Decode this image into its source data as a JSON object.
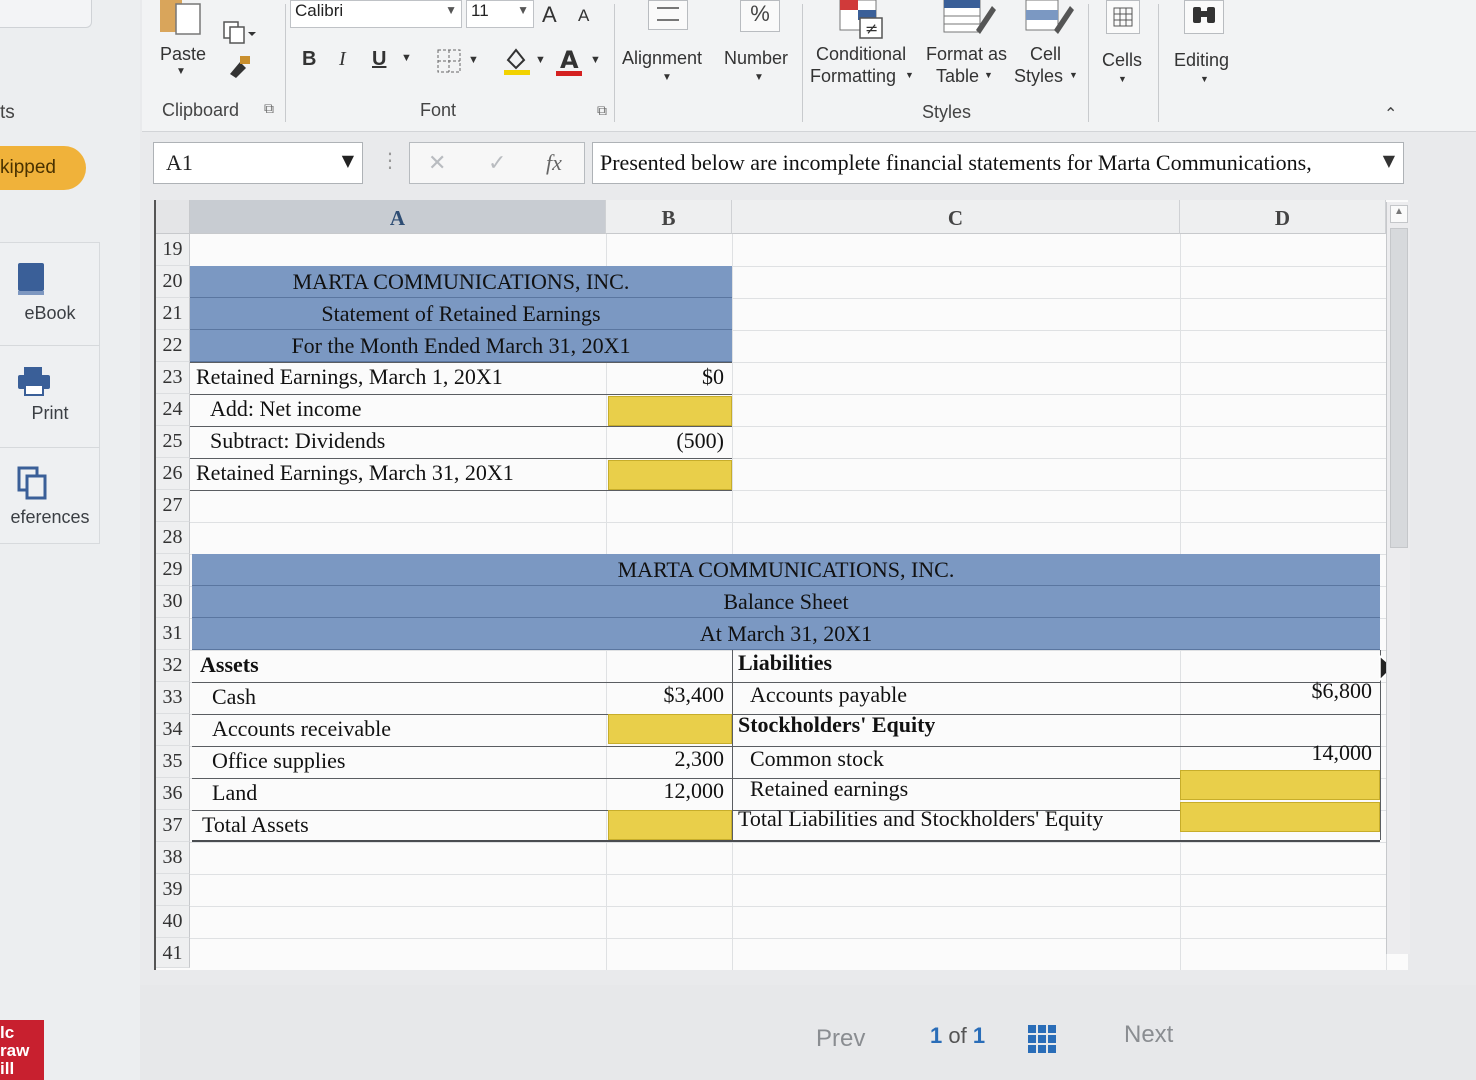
{
  "siderail": {
    "top_text": "ts",
    "skipped": "kipped",
    "ebook": "eBook",
    "print": "Print",
    "references": "eferences",
    "logo_lines": [
      "lc",
      "raw",
      "ill"
    ]
  },
  "ribbon": {
    "paste": "Paste",
    "clipboard": "Clipboard",
    "font_name": "Calibri",
    "font_size": "11",
    "grow_font": "A",
    "shrink_font": "A",
    "bold": "B",
    "italic": "I",
    "underline": "U",
    "font_group": "Font",
    "alignment": "Alignment",
    "number": "Number",
    "number_symbol": "%",
    "conditional_formatting_1": "Conditional",
    "conditional_formatting_2": "Formatting",
    "format_as_table_1": "Format as",
    "format_as_table_2": "Table",
    "cell_styles_1": "Cell",
    "cell_styles_2": "Styles",
    "styles_group": "Styles",
    "cells": "Cells",
    "editing": "Editing"
  },
  "formula_bar": {
    "name_box": "A1",
    "fx": "fx",
    "content": "Presented below are incomplete financial statements for Marta Communications,"
  },
  "columns": [
    "A",
    "B",
    "C",
    "D"
  ],
  "rows": [
    "19",
    "20",
    "21",
    "22",
    "23",
    "24",
    "25",
    "26",
    "27",
    "28",
    "29",
    "30",
    "31",
    "32",
    "33",
    "34",
    "35",
    "36",
    "37",
    "38",
    "39",
    "40",
    "41"
  ],
  "retained_earnings_statement": {
    "company": "MARTA COMMUNICATIONS, INC.",
    "title": "Statement of Retained Earnings",
    "period": "For the Month Ended  March 31, 20X1",
    "lines": [
      {
        "label": "Retained Earnings, March 1, 20X1",
        "value": "$0"
      },
      {
        "label": "Add: Net income",
        "value": ""
      },
      {
        "label": "Subtract: Dividends",
        "value": "(500)"
      },
      {
        "label": "Retained Earnings, March 31, 20X1",
        "value": ""
      }
    ]
  },
  "balance_sheet": {
    "company": "MARTA COMMUNICATIONS, INC.",
    "title": "Balance Sheet",
    "date": "At March 31, 20X1",
    "assets_header": "Assets",
    "assets": [
      {
        "label": "Cash",
        "value": "$3,400"
      },
      {
        "label": "Accounts receivable",
        "value": ""
      },
      {
        "label": "Office supplies",
        "value": "2,300"
      },
      {
        "label": "Land",
        "value": "12,000"
      }
    ],
    "total_assets_label": "Total Assets",
    "liabilities_header": "Liabilities",
    "accounts_payable_label": "Accounts payable",
    "accounts_payable_value": "$6,800",
    "equity_header": "Stockholders' Equity",
    "common_stock_label": "Common stock",
    "common_stock_value": "14,000",
    "retained_earnings_label": "Retained earnings",
    "total_liab_equity_label": "Total Liabilities and Stockholders' Equity"
  },
  "bottom_nav": {
    "prev": "Prev",
    "page_current": "1",
    "page_of": "of",
    "page_total": "1",
    "next": "Next"
  },
  "colors": {
    "header_band": "#7b98c2",
    "input_cell": "#e9cf4a",
    "skipped_badge": "#f0b23a"
  }
}
